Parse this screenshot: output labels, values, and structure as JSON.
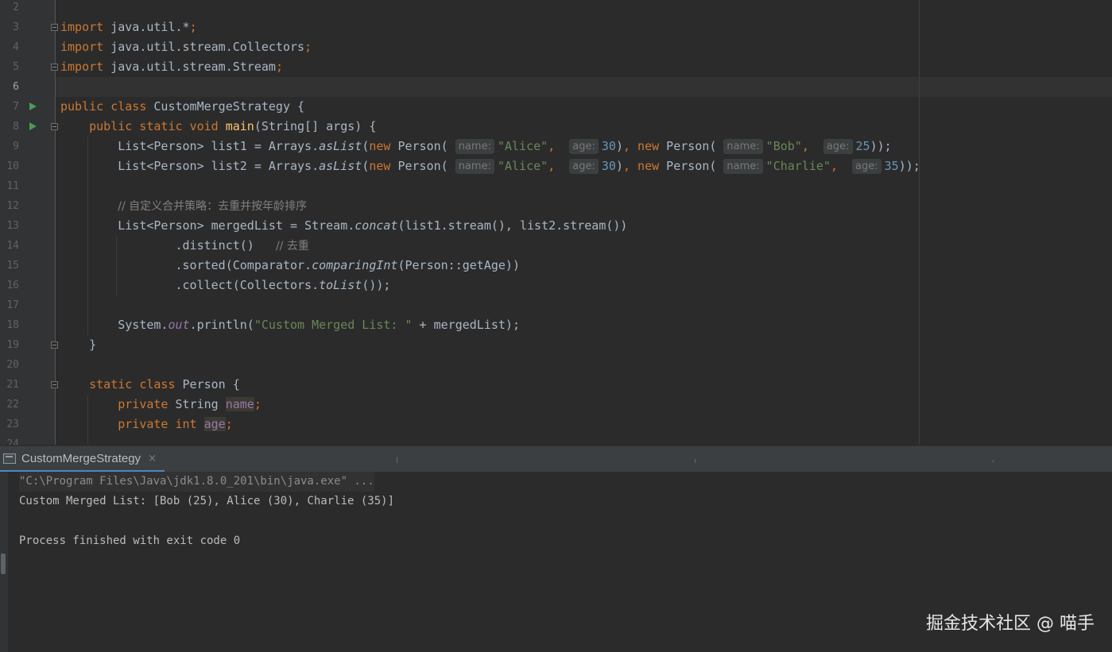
{
  "editor": {
    "current_line": 6,
    "lines": [
      {
        "n": "2"
      },
      {
        "n": "3"
      },
      {
        "n": "4"
      },
      {
        "n": "5"
      },
      {
        "n": "6"
      },
      {
        "n": "7"
      },
      {
        "n": "8"
      },
      {
        "n": "9"
      },
      {
        "n": "10"
      },
      {
        "n": "11"
      },
      {
        "n": "12"
      },
      {
        "n": "13"
      },
      {
        "n": "14"
      },
      {
        "n": "15"
      },
      {
        "n": "16"
      },
      {
        "n": "17"
      },
      {
        "n": "18"
      },
      {
        "n": "19"
      },
      {
        "n": "20"
      },
      {
        "n": "21"
      },
      {
        "n": "22"
      },
      {
        "n": "23"
      },
      {
        "n": "24"
      }
    ],
    "code": {
      "kw_import": "import",
      "pkg_util_star": " java.util.*",
      "semicolon": ";",
      "pkg_collectors": " java.util.stream.Collectors",
      "pkg_stream": " java.util.stream.Stream",
      "kw_public": "public",
      "kw_class": "class",
      "kw_static": "static",
      "kw_void": "void",
      "kw_new": "new",
      "kw_private": "private",
      "kw_int": "int",
      "class_name": " CustomMergeStrategy {",
      "main": "main",
      "main_args": "(String[] args) {",
      "list_type": "List<Person>",
      "list1_decl": " list1 = Arrays.",
      "list2_decl": " list2 = Arrays.",
      "as_list": "asList",
      "paren_open": "(",
      "person_ctor": " Person(",
      "hint_name": "name:",
      "hint_age": "age:",
      "str_alice": "\"Alice\"",
      "str_bob": "\"Bob\"",
      "str_charlie": "\"Charlie\"",
      "comma": ",",
      "num_30": "30",
      "num_25": "25",
      "num_35": "35",
      "close_paren": ")",
      "close_end": "));",
      "comment_strategy": "// 自定义合并策略：去重并按年龄排序",
      "merged_decl": " mergedList = Stream.",
      "concat": "concat",
      "concat_args": "(list1.stream(), list2.stream())",
      "distinct": ".distinct()",
      "comment_dedup": "// 去重",
      "sorted_open": ".sorted(Comparator.",
      "comparing_int": "comparingInt",
      "sorted_args": "(Person::getAge))",
      "collect_open": ".collect(Collectors.",
      "to_list": "toList",
      "collect_close": "());",
      "system": "System.",
      "out": "out",
      "println_open": ".println(",
      "str_custom": "\"Custom Merged List: \"",
      "println_rest": " + mergedList);",
      "close_brace": "}",
      "person_class": " Person {",
      "type_string": " String ",
      "field_name": "name",
      "field_age": "age"
    }
  },
  "run_panel": {
    "tab_label": "CustomMergeStrategy",
    "close": "×",
    "console_lines": [
      "\"C:\\Program Files\\Java\\jdk1.8.0_201\\bin\\java.exe\" ...",
      "Custom Merged List: [Bob (25), Alice (30), Charlie (35)]",
      "Process finished with exit code 0"
    ]
  },
  "watermark": "掘金技术社区 @ 喵手",
  "colors": {
    "background": "#2b2b2b",
    "keyword": "#cc7832",
    "string": "#6a8759",
    "number": "#6897bb",
    "method_decl": "#ffc66d",
    "field": "#9876aa",
    "comment": "#808080",
    "run_icon": "#499c54"
  },
  "icons": [
    "run-icon",
    "fold-icon",
    "console-icon",
    "close-icon"
  ]
}
